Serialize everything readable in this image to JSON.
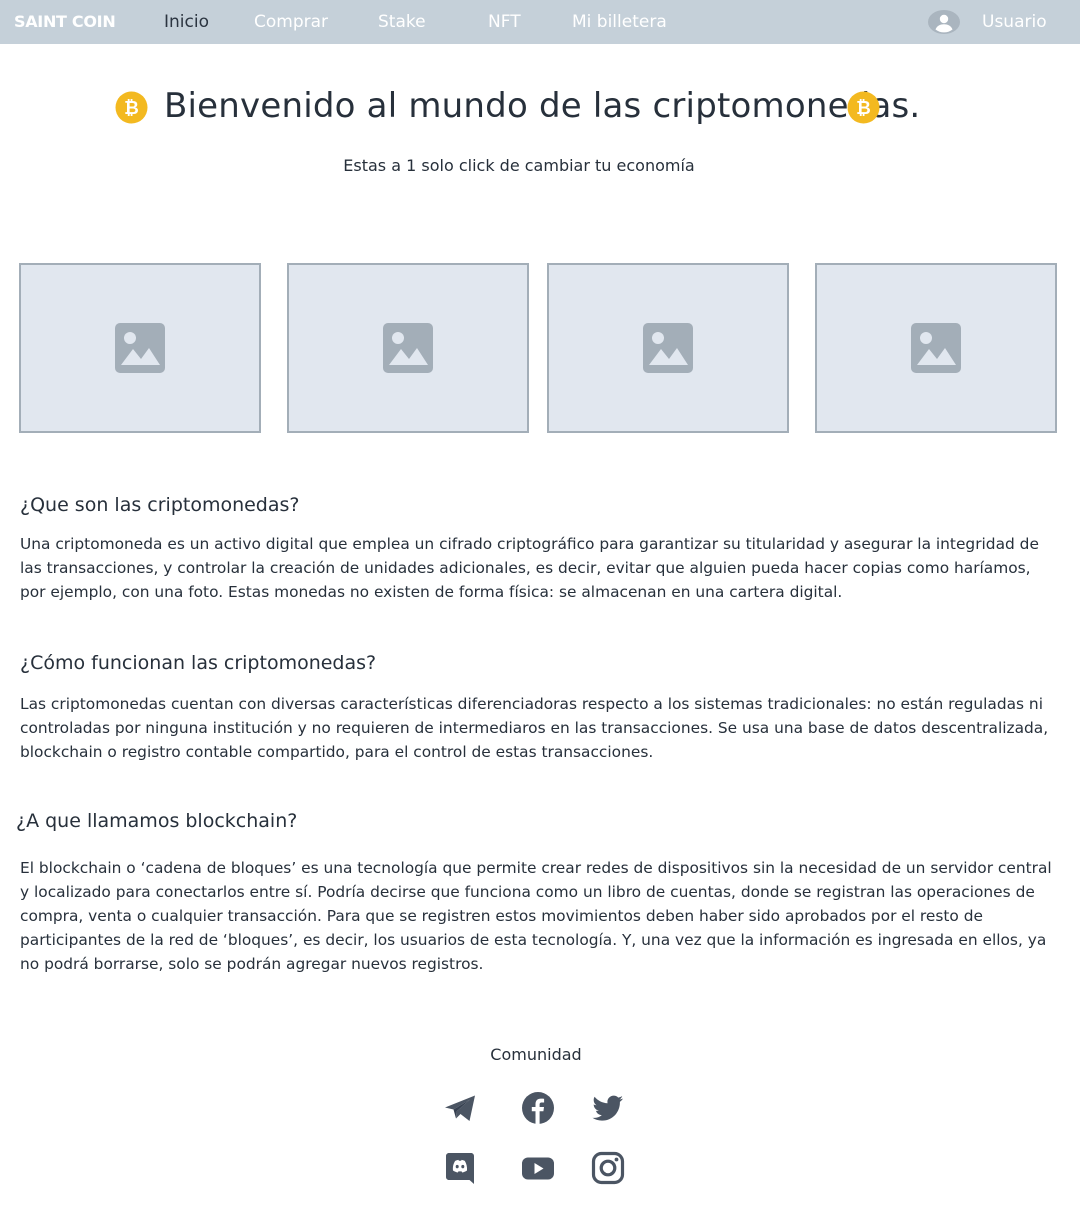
{
  "nav": {
    "brand": "SAINT COIN",
    "links": [
      "Inicio",
      "Comprar",
      "Stake",
      "NFT",
      "Mi billetera"
    ],
    "user": "Usuario",
    "user_icon": "user-avatar-icon"
  },
  "hero": {
    "title": "Bienvenido al mundo de las criptomonedas.",
    "subtitle": "Estas a 1 solo click de cambiar tu economía",
    "coin_icon": "bitcoin-icon",
    "coin_color": "#f3b920"
  },
  "gallery": {
    "icon": "image-placeholder-icon",
    "count": 4
  },
  "sections": [
    {
      "title": "¿Que son las criptomonedas?",
      "body": "Una criptomoneda es un activo digital que emplea un cifrado criptográfico para garantizar su titularidad y asegurar la integridad de las transacciones, y controlar la creación de unidades adicionales, es decir, evitar que alguien pueda hacer copias como haríamos, por ejemplo, con una foto. Estas monedas no existen de forma física: se almacenan en una cartera digital."
    },
    {
      "title": "¿Cómo funcionan las criptomonedas?",
      "body": "Las criptomonedas cuentan con diversas características diferenciadoras respecto a los sistemas tradicionales: no están reguladas ni controladas por ninguna institución y no requieren de intermediaros en las transacciones. Se usa una base de datos descentralizada, blockchain o registro contable compartido, para el control de estas transacciones."
    },
    {
      "title": "¿A que llamamos blockchain?",
      "body": "El blockchain o ‘cadena de bloques’ es una tecnología que permite crear redes de dispositivos sin la necesidad de un servidor central y localizado para conectarlos entre sí. Podría decirse que funciona como un libro de cuentas, donde se registran las operaciones de compra, venta o cualquier transacción. Para que se registren estos movimientos deben haber sido aprobados por el resto de participantes de la red de ‘bloques’, es decir, los usuarios de esta tecnología. Y, una vez que la información es ingresada en ellos, ya no podrá borrarse, solo se podrán agregar nuevos registros."
    }
  ],
  "footer": {
    "community_label": "Comunidad",
    "socials": [
      "telegram-icon",
      "facebook-icon",
      "twitter-icon",
      "discord-icon",
      "youtube-icon",
      "instagram-icon"
    ]
  },
  "colors": {
    "navbar_bg": "#c5d0d9",
    "active_link": "#2b3440",
    "text": "#27303b",
    "placeholder_bg": "#e1e7ef",
    "placeholder_icon": "#a3aeb8",
    "social_icon": "#4b5563"
  }
}
